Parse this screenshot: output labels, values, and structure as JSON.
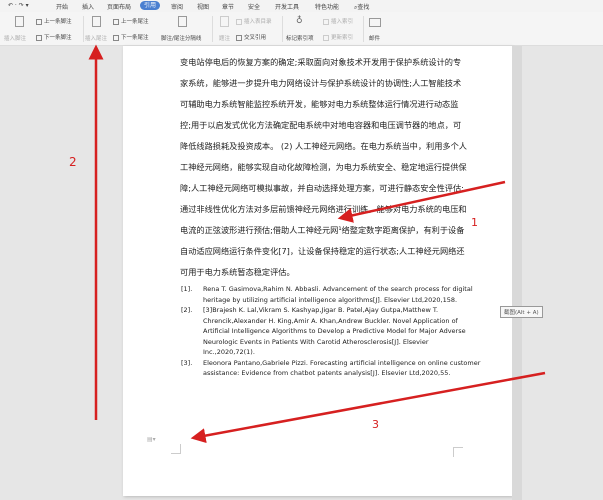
{
  "menu": {
    "tabs": [
      "开始",
      "插入",
      "页面布局",
      "引用",
      "审阅",
      "视图",
      "章节",
      "安全",
      "开发工具",
      "特色功能"
    ],
    "search": "查找",
    "active": "引用"
  },
  "ribbon": {
    "insert_footnote": "插入脚注",
    "prev_footnote": "上一条脚注",
    "next_footnote": "下一条脚注",
    "insert_endnote": "插入尾注",
    "prev_endnote": "上一条尾注",
    "next_endnote": "下一条尾注",
    "separator": "脚注/尾注分隔线",
    "caption": "题注",
    "insert_toc": "插入表目录",
    "cross_ref": "交叉引用",
    "mark_index": "标记索引项",
    "insert_index": "插入索引",
    "update_index": "更新索引",
    "mail": "邮件"
  },
  "body_lines": [
    "变电站停电后的恢复方案的确定;采取面向对象技术开发用于保护系统设计的专",
    "家系统，能够进一步提升电力网络设计与保护系统设计的协调性;人工智能技术",
    "可辅助电力系统智能监控系统开发，能够对电力系统整体运行情况进行动态监",
    "控;用于以启发式优化方法确定配电系统中对地电容器和电压调节器的地点，可",
    "降低线路损耗及投资成本。 (2) 人工神经元网络。在电力系统当中，利用多个人",
    "工神经元网络，能够实现自动化故障检测，为电力系统安全、稳定地运行提供保",
    "障;人工神经元网络可模拟事故，并自动选择处理方案，可进行静态安全性评估;",
    "通过非线性优化方法对多层前馈神经元网络进行训练，能够对电力系统的电压和",
    "电流的正弦波形进行预估;借助人工神经元网¹络整定数字距离保护，有利于设备",
    "自动适应网络运行条件变化[7]，让设备保持稳定的运行状态;人工神经元网络还",
    "可用于电力系统暂态稳定评估。"
  ],
  "references": [
    {
      "num": "[1].",
      "text": "Rena T. Gasimova,Rahim N. Abbasli. Advancement of the search process for digital heritage by utilizing artificial intelligence algorithms[J]. Elsevier Ltd,2020,158."
    },
    {
      "num": "[2].",
      "text": "[3]Brajesh K. Lal,Vikram S. Kashyap,Jigar B. Patel,Ajay Gutpa,Matthew T. Chrencik,Alexander H. King,Amir A. Khan,Andrew Buckler. Novel Application of Artificial Intelligence Algorithms to Develop a Predictive Model for Major Adverse Neurologic Events in Patients With Carotid Atherosclerosis[J]. Elsevier Inc.,2020,72(1)."
    },
    {
      "num": "[3].",
      "text": "Eleonora Pantano,Gabriele Pizzi. Forecasting artificial intelligence on online customer assistance: Evidence from chatbot patents analysis[J]. Elsevier Ltd,2020,55."
    }
  ],
  "tooltip": "截图(Alt + A)",
  "annotations": {
    "a1": "1",
    "a2": "2",
    "a3": "3",
    "color": "#d62020"
  }
}
